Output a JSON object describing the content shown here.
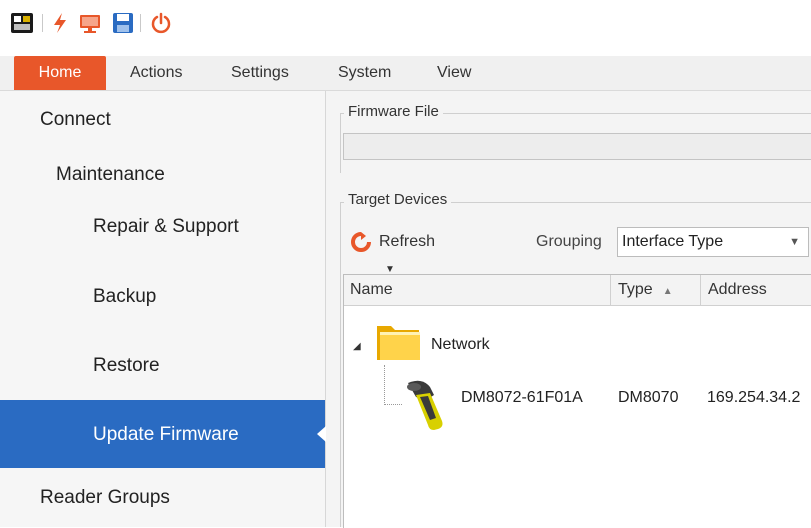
{
  "toolbar": {
    "icons": [
      "app-logo-icon",
      "lightning-icon",
      "monitor-icon",
      "save-icon",
      "power-icon"
    ],
    "colors": {
      "lightning": "#e8572a",
      "monitor": "#e8572a",
      "save": "#2a6bc2",
      "power": "#e8572a"
    }
  },
  "ribbon": {
    "tabs": [
      {
        "label": "Home",
        "active": true
      },
      {
        "label": "Actions"
      },
      {
        "label": "Settings"
      },
      {
        "label": "System"
      },
      {
        "label": "View"
      }
    ],
    "accent": "#e8572a"
  },
  "nav": {
    "items": [
      {
        "label": "Connect"
      },
      {
        "label": "Maintenance"
      },
      {
        "label": "Repair & Support"
      },
      {
        "label": "Backup"
      },
      {
        "label": "Restore"
      },
      {
        "label": "Update Firmware",
        "selected": true
      },
      {
        "label": "Reader Groups"
      }
    ],
    "selected_color": "#2a6bc2"
  },
  "firmware": {
    "group_title": "Firmware File",
    "value": ""
  },
  "targets": {
    "group_title": "Target Devices",
    "refresh_label": "Refresh",
    "grouping_label": "Grouping",
    "grouping_value": "Interface Type",
    "columns": [
      "Name",
      "Type",
      "Address"
    ],
    "tree": {
      "group_label": "Network",
      "devices": [
        {
          "name": "DM8072-61F01A",
          "type": "DM8070",
          "address": "169.254.34.2"
        }
      ]
    }
  }
}
